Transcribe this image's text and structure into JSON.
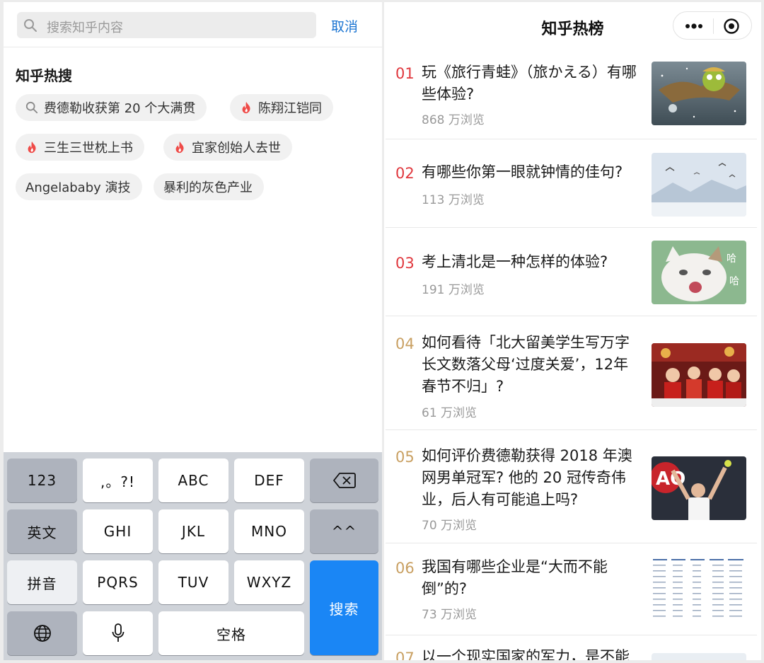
{
  "search": {
    "placeholder": "搜索知乎内容",
    "cancel_label": "取消"
  },
  "hot_search": {
    "title": "知乎热搜",
    "chips": [
      {
        "label": "费德勒收获第 20 个大满贯",
        "icon": "search-icon"
      },
      {
        "label": "陈翔江铠同",
        "icon": "fire-icon"
      },
      {
        "label": "三生三世枕上书",
        "icon": "fire-icon"
      },
      {
        "label": "宜家创始人去世",
        "icon": "fire-icon"
      },
      {
        "label": "Angelababy 演技",
        "icon": ""
      },
      {
        "label": "暴利的灰色产业",
        "icon": ""
      }
    ]
  },
  "keyboard": {
    "keys": {
      "num": "123",
      "punct": ",。?!",
      "abc": "ABC",
      "def": "DEF",
      "english": "英文",
      "ghi": "GHI",
      "jkl": "JKL",
      "mno": "MNO",
      "caret": "^^",
      "pinyin": "拼音",
      "pqrs": "PQRS",
      "tuv": "TUV",
      "wxyz": "WXYZ",
      "search": "搜索",
      "space": "空格"
    }
  },
  "hot_list": {
    "title": "知乎热榜",
    "items": [
      {
        "rank": "01",
        "title": "玩《旅行青蛙》（旅かえる）有哪些体验?",
        "views": "868 万浏览"
      },
      {
        "rank": "02",
        "title": "有哪些你第一眼就钟情的佳句?",
        "views": "113 万浏览"
      },
      {
        "rank": "03",
        "title": "考上清北是一种怎样的体验?",
        "views": "191 万浏览"
      },
      {
        "rank": "04",
        "title": "如何看待「北大留美学生写万字长文数落父母‘过度关爱’，12年春节不归」?",
        "views": "61 万浏览"
      },
      {
        "rank": "05",
        "title": "如何评价费德勒获得 2018 年澳网男单冠军? 他的 20 冠传奇伟业，后人有可能追上吗?",
        "views": "70 万浏览"
      },
      {
        "rank": "06",
        "title": "我国有哪些企业是“大而不能倒”的?",
        "views": "73 万浏览"
      },
      {
        "rank": "07",
        "title": "以一个现实国家的军力，是不能",
        "views": ""
      }
    ]
  },
  "colors": {
    "accent_blue": "#1a74d2",
    "rank_red": "#e0383e",
    "rank_gold": "#c9a062",
    "key_search_blue": "#1a86f5"
  }
}
